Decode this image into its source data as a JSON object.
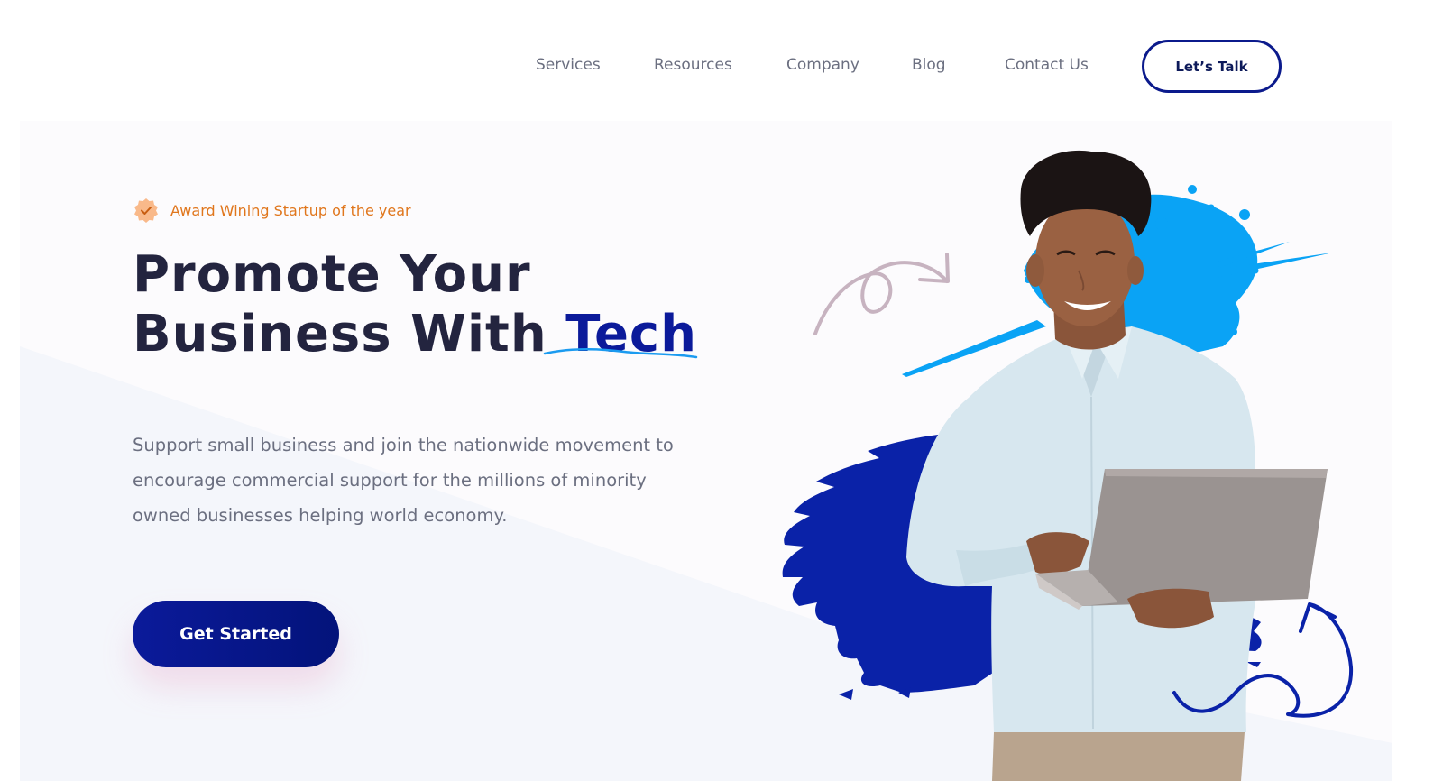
{
  "nav": {
    "items": [
      {
        "label": "Services"
      },
      {
        "label": "Resources"
      },
      {
        "label": "Company"
      },
      {
        "label": "Blog"
      },
      {
        "label": "Contact Us"
      }
    ],
    "cta_label": "Let’s Talk"
  },
  "hero": {
    "badge_icon": "checkmark-badge-icon",
    "badge_text": "Award Wining Startup of the year",
    "headline_line1": "Promote Your",
    "headline_line2_prefix": "Business With ",
    "headline_accent": "Tech",
    "description": "Support small business and join the nationwide movement to encourage commercial support for the millions of minority owned businesses helping world economy.",
    "button_label": "Get Started"
  },
  "colors": {
    "brand_navy": "#0b1a9a",
    "heading": "#23243f",
    "body_text": "#6b6f80",
    "badge_orange": "#e0761c",
    "splash_blue": "#0aa3f5",
    "brush_blue": "#0a22a8"
  }
}
